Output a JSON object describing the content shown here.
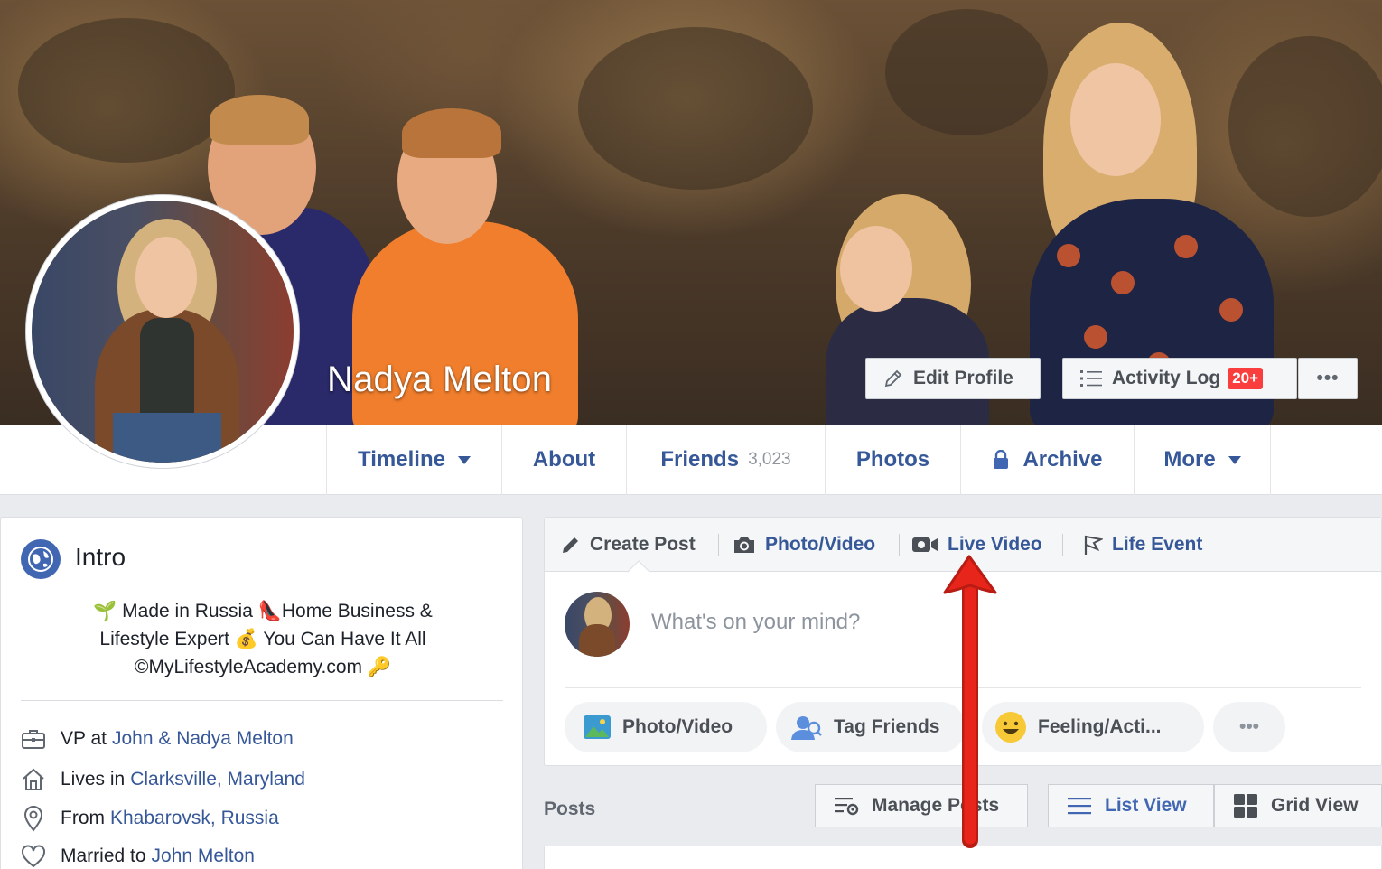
{
  "profile": {
    "name": "Nadya Melton",
    "cover_alt": "Family photo cover"
  },
  "cover_actions": {
    "edit_profile": "Edit Profile",
    "activity_log": "Activity Log",
    "activity_badge": "20+",
    "more_glyph": "•••"
  },
  "nav": {
    "timeline": "Timeline",
    "about": "About",
    "friends": "Friends",
    "friends_count": "3,023",
    "photos": "Photos",
    "archive": "Archive",
    "more": "More"
  },
  "intro": {
    "title": "Intro",
    "bio_line1": "🌱 Made in Russia 👠Home Business &",
    "bio_line2": "Lifestyle Expert 💰 You Can Have It All",
    "bio_line3": "©MyLifestyleAcademy.com 🔑",
    "work_prefix": "VP at",
    "work_link": "John & Nadya Melton",
    "lives_prefix": "Lives in",
    "lives_link": "Clarksville, Maryland",
    "from_prefix": "From",
    "from_link": "Khabarovsk, Russia",
    "married_prefix": "Married to",
    "married_link": "John Melton"
  },
  "composer": {
    "tab_create": "Create Post",
    "tab_photo": "Photo/Video",
    "tab_live": "Live Video",
    "tab_life": "Life Event",
    "placeholder": "What's on your mind?",
    "pill_photo": "Photo/Video",
    "pill_tag": "Tag Friends",
    "pill_feeling": "Feeling/Acti...",
    "pill_more": "•••"
  },
  "posts": {
    "label": "Posts",
    "manage": "Manage Posts",
    "list_view": "List View",
    "grid_view": "Grid View"
  },
  "colors": {
    "link": "#365899",
    "brand": "#4267b2",
    "badge": "#fa3e3e",
    "annotation_arrow": "#e8251b"
  }
}
